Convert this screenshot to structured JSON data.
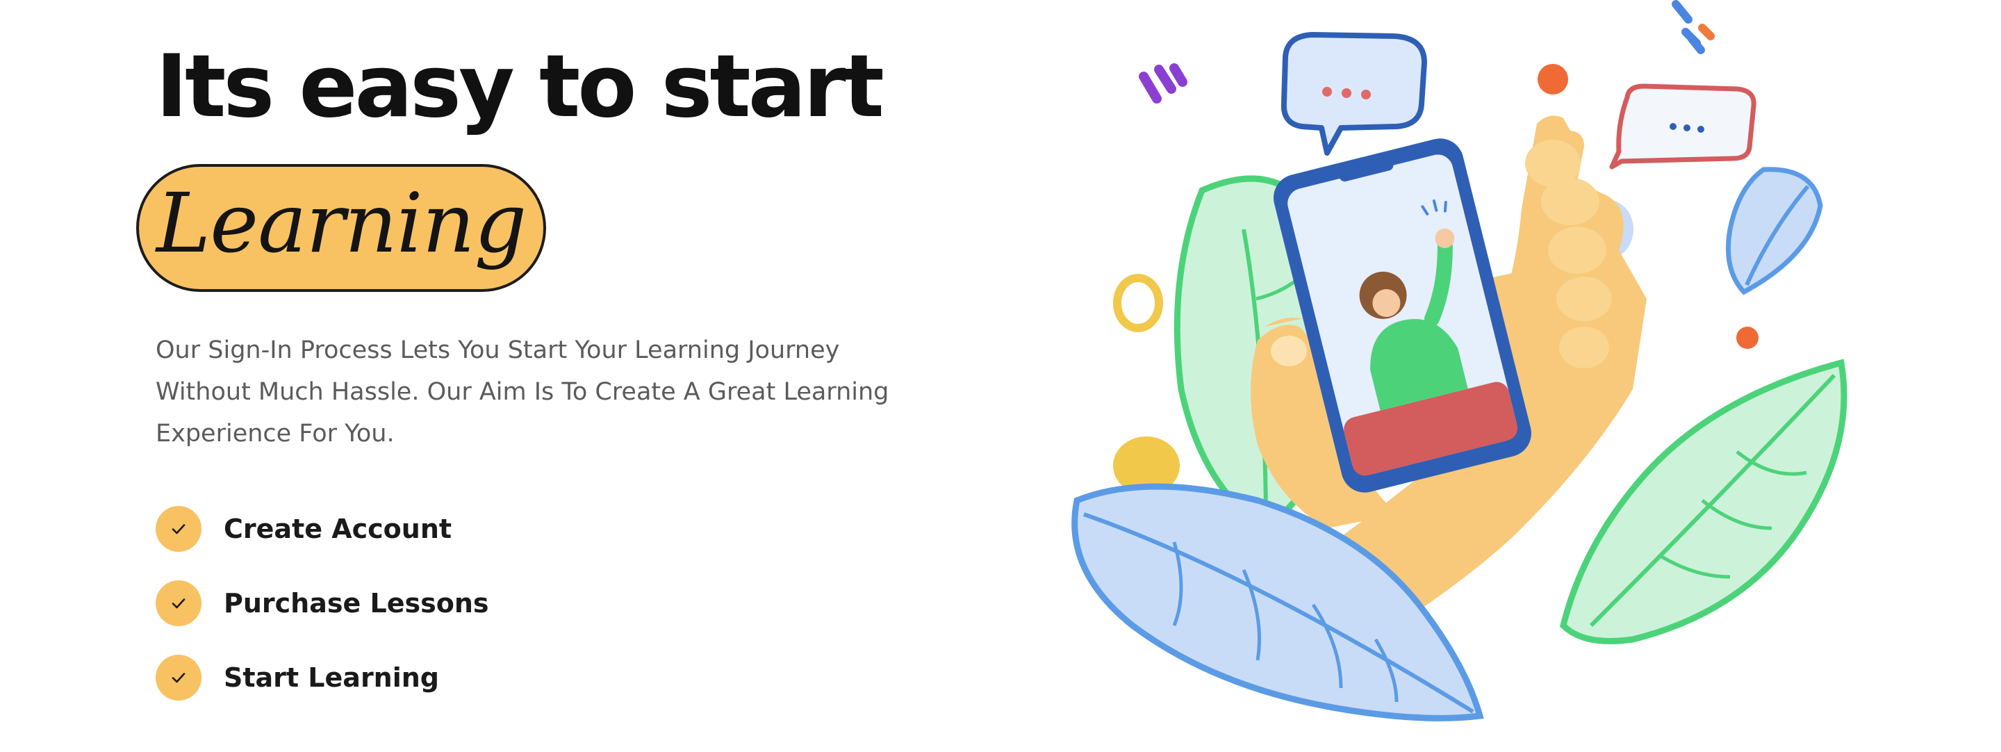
{
  "hero": {
    "headline": "Its easy to start",
    "highlight": "Learning",
    "description": "Our Sign-In Process Lets You Start Your Learning Journey Without Much Hassle. Our Aim Is To Create A Great Learning Experience For You."
  },
  "steps": [
    {
      "label": "Create Account",
      "icon": "checkmark-icon"
    },
    {
      "label": "Purchase Lessons",
      "icon": "checkmark-icon"
    },
    {
      "label": "Start Learning",
      "icon": "checkmark-icon"
    }
  ],
  "colors": {
    "accent": "#f8c262",
    "text": "#111111",
    "muted": "#5b5b5b",
    "leaf_green": "#4cd37a",
    "leaf_blue": "#5b9be6",
    "phone_frame": "#2f5fb5",
    "phone_red": "#d35c5c"
  }
}
